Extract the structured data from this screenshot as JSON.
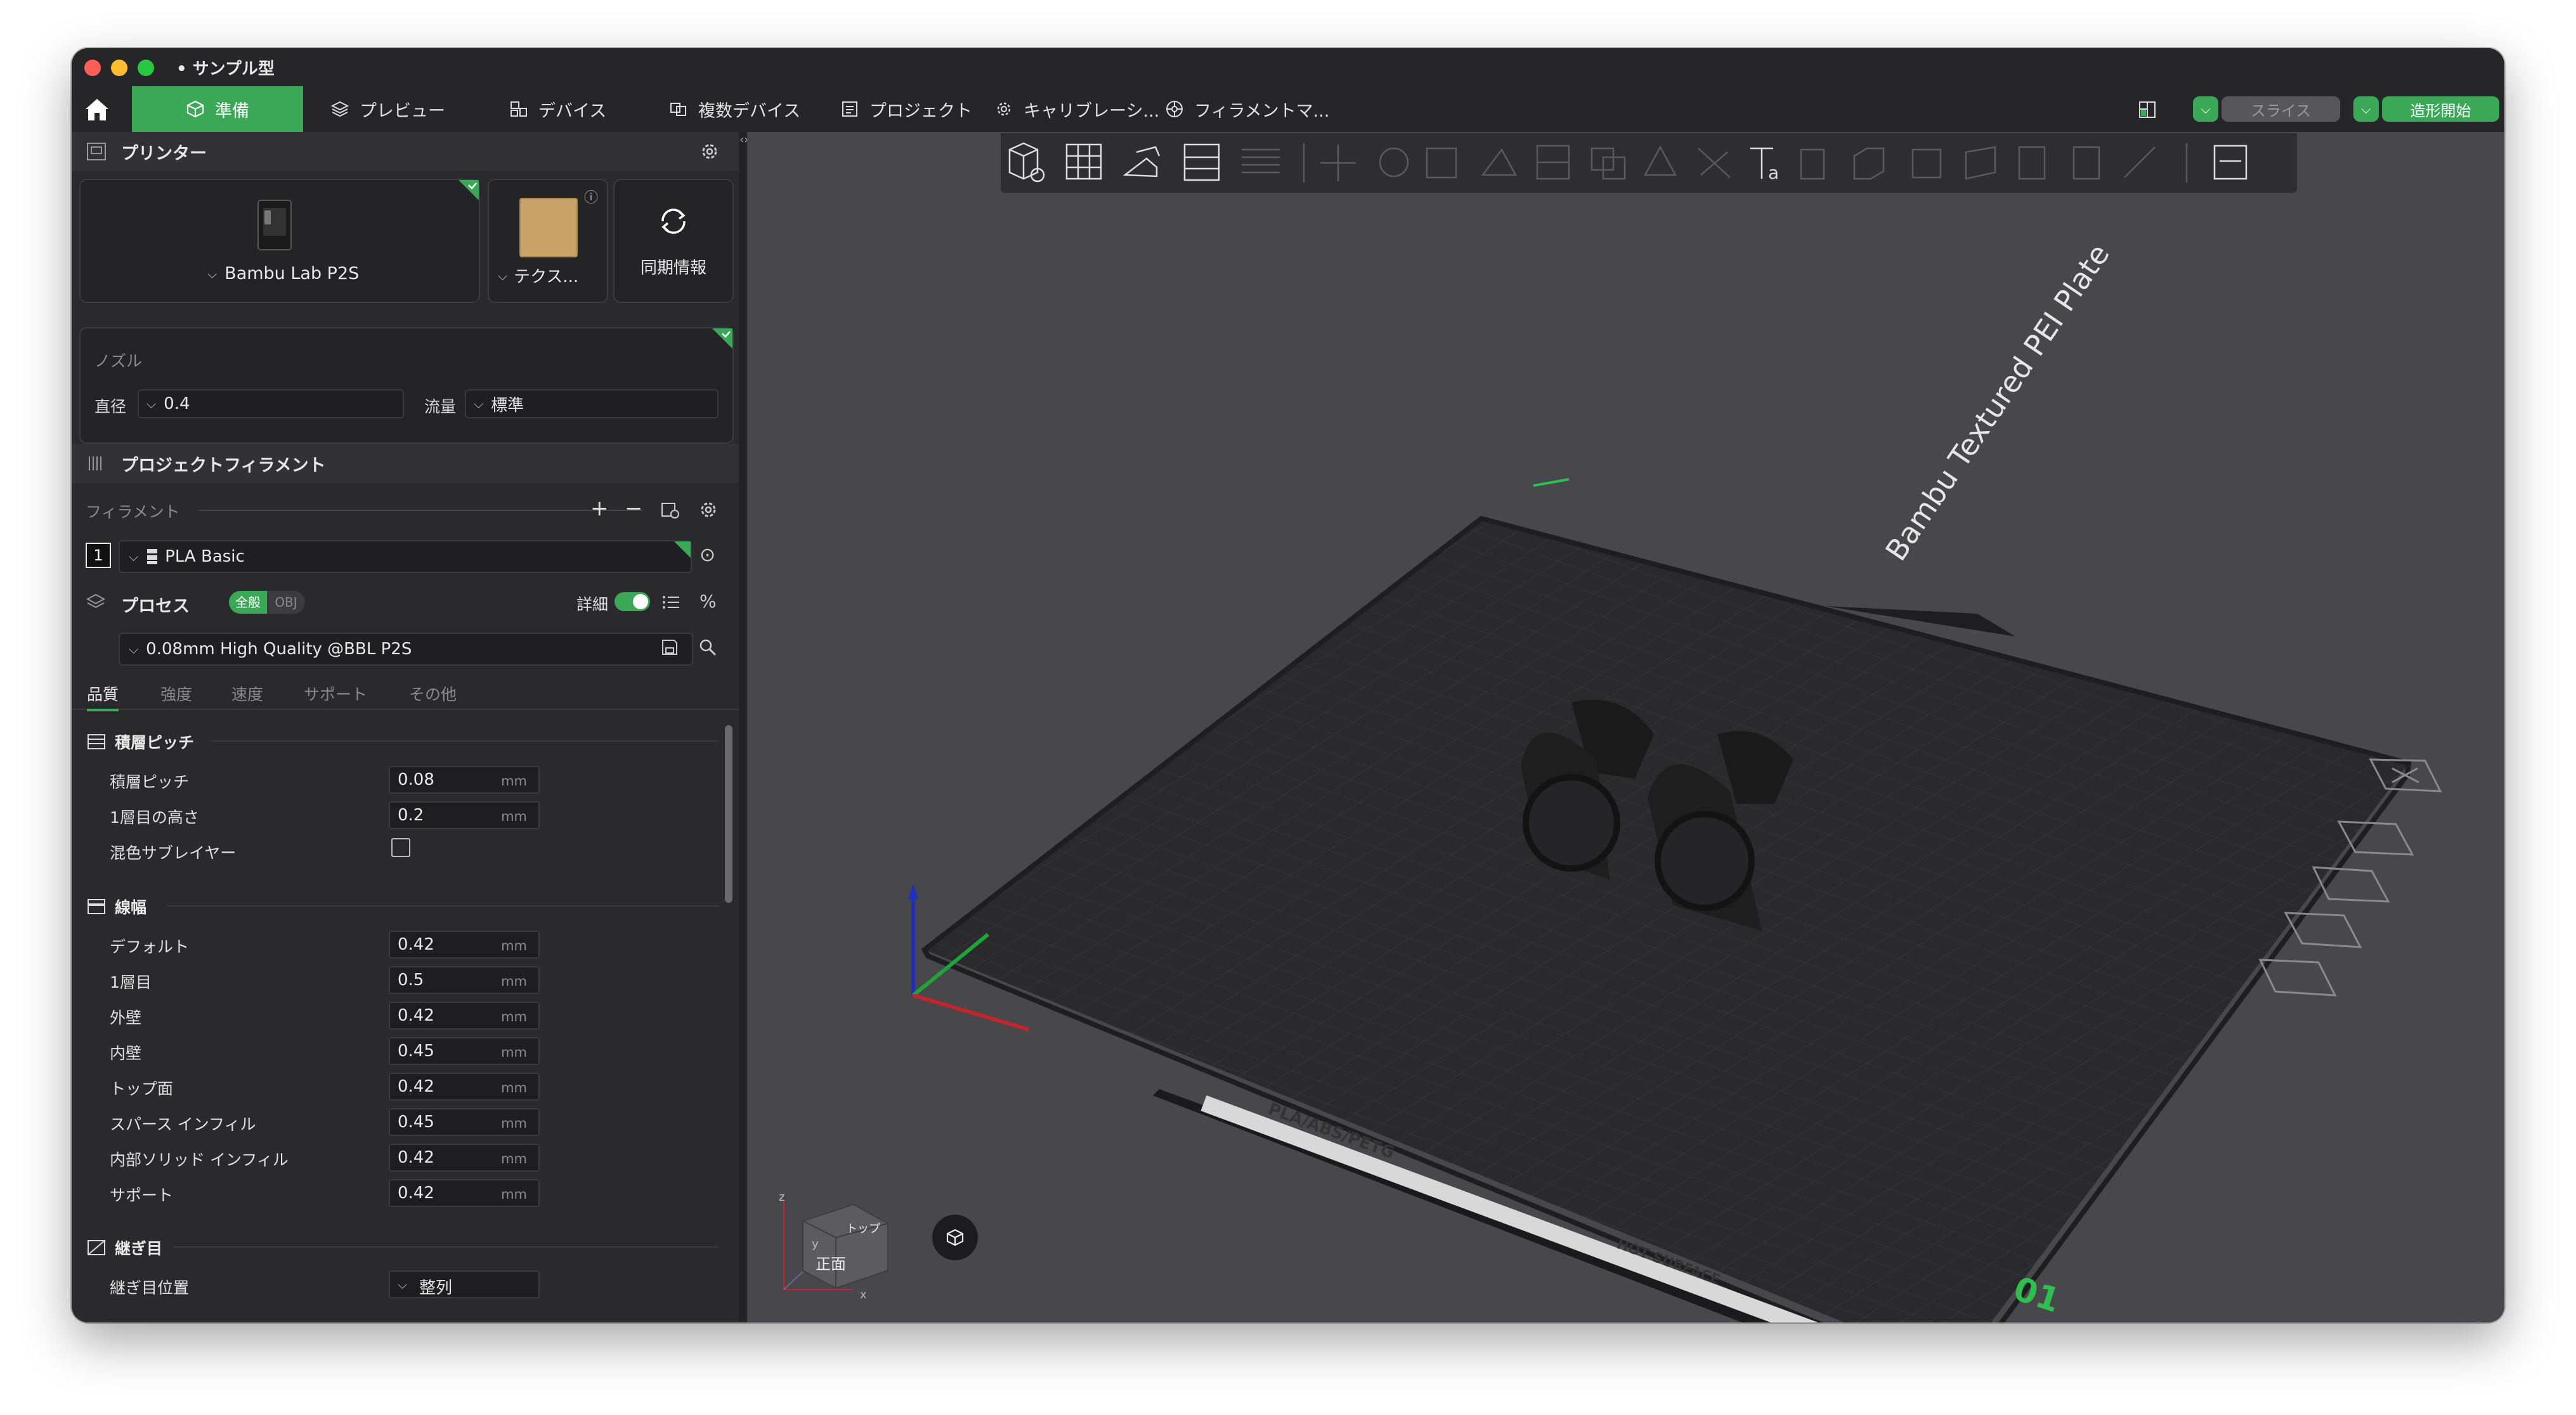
{
  "window": {
    "title": "• サンプル型"
  },
  "tabs": [
    {
      "label": "準備",
      "icon": "cube-icon"
    },
    {
      "label": "プレビュー",
      "icon": "layers-icon"
    },
    {
      "label": "デバイス",
      "icon": "device-icon"
    },
    {
      "label": "複数デバイス",
      "icon": "multi-device-icon"
    },
    {
      "label": "プロジェクト",
      "icon": "project-icon"
    },
    {
      "label": "キャリブレーシ...",
      "icon": "calibration-icon"
    },
    {
      "label": "フィラメントマ...",
      "icon": "filament-manager-icon"
    }
  ],
  "actions": {
    "slice": "スライス",
    "print": "造形開始"
  },
  "printer": {
    "header": "プリンター",
    "name": "Bambu Lab P2S",
    "plate": "テクス...",
    "sync": "同期情報"
  },
  "nozzle": {
    "title": "ノズル",
    "diameter_label": "直径",
    "diameter_value": "0.4",
    "flow_label": "流量",
    "flow_value": "標準"
  },
  "filament": {
    "header": "プロジェクトフィラメント",
    "sub_label": "フィラメント",
    "slot_number": "1",
    "slot_name": "PLA Basic"
  },
  "process": {
    "label": "プロセス",
    "badge_all": "全般",
    "badge_obj": "OBJ",
    "detail": "詳細",
    "preset": "0.08mm High Quality @BBL P2S",
    "subtabs": [
      "品質",
      "強度",
      "速度",
      "サポート",
      "その他"
    ]
  },
  "settings": {
    "layer_group": "積層ピッチ",
    "layer_height_label": "積層ピッチ",
    "layer_height": "0.08",
    "first_layer_label": "1層目の高さ",
    "first_layer": "0.2",
    "mix_label": "混色サブレイヤー",
    "width_group": "線幅",
    "unit": "mm",
    "widths": [
      {
        "label": "デフォルト",
        "value": "0.42"
      },
      {
        "label": "1層目",
        "value": "0.5"
      },
      {
        "label": "外壁",
        "value": "0.42"
      },
      {
        "label": "内壁",
        "value": "0.45"
      },
      {
        "label": "トップ面",
        "value": "0.42"
      },
      {
        "label": "スパース インフィル",
        "value": "0.45"
      },
      {
        "label": "内部ソリッド インフィル",
        "value": "0.42"
      },
      {
        "label": "サポート",
        "value": "0.42"
      }
    ],
    "seam_group": "継ぎ目",
    "seam_position_label": "継ぎ目位置",
    "seam_position": "整列"
  },
  "viewport": {
    "plate_title": "Bambu Textured PEI Plate",
    "plate_front": "PLA/ABS/PETG",
    "hot_surface": "HOT SURFACE",
    "plate_number": "01",
    "cube_front": "正面",
    "cube_top": "トップ",
    "axis_x": "x",
    "axis_y": "y",
    "axis_z": "z"
  },
  "colors": {
    "accent": "#3aa856",
    "panel": "#2a2a2d",
    "viewport": "#48484c"
  }
}
